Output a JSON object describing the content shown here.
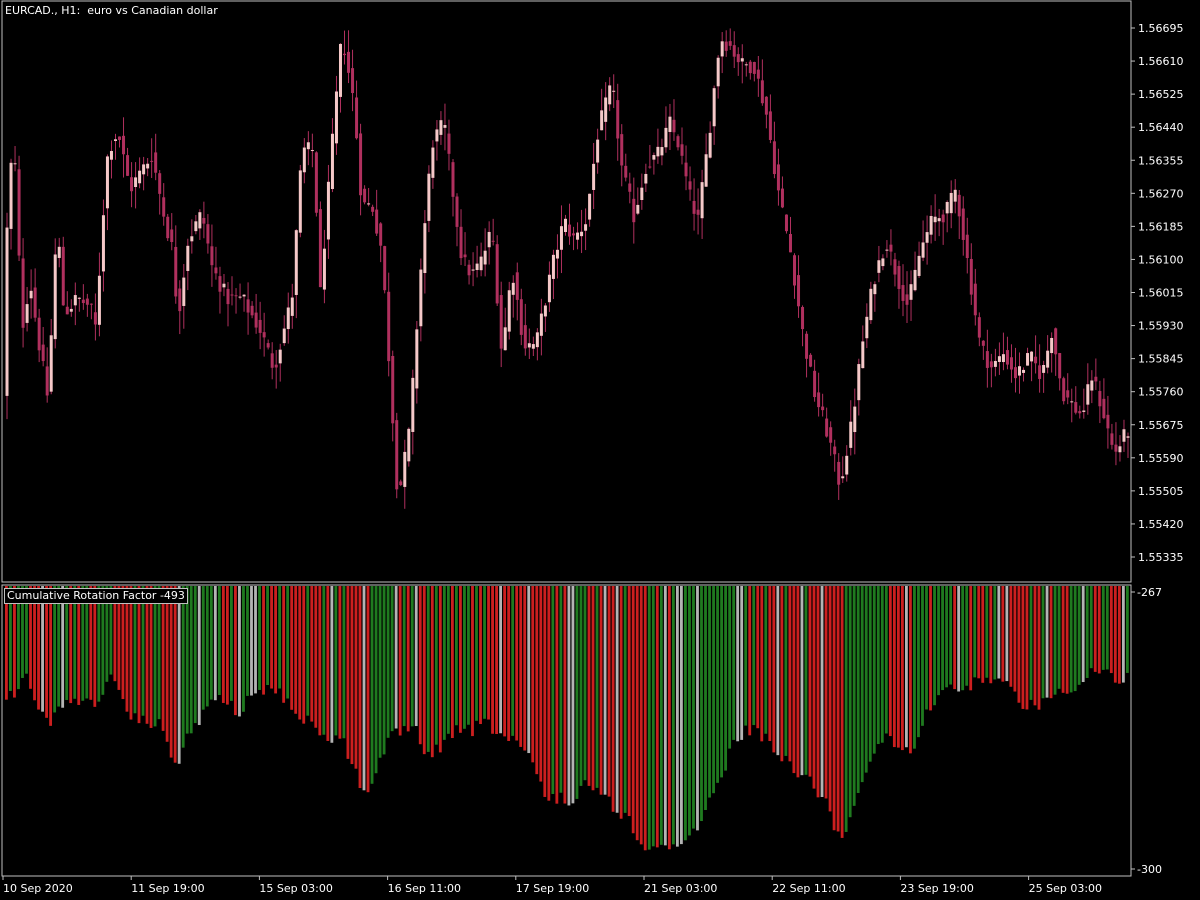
{
  "symbol": "EURCAD.",
  "timeframe": "H1",
  "description": "euro vs Canadian dollar",
  "indicator": {
    "name": "Cumulative Rotation Factor",
    "value": -493
  },
  "colors": {
    "background": "#000000",
    "frame": "#c0c0c0",
    "candle_bull_body": "#f5c8c8",
    "candle_bear_body": "#b0305e",
    "wick": "#b0305e",
    "hist_green": "#1f7a1f",
    "hist_red": "#cc1f1f",
    "hist_gray": "#b4b4b4"
  },
  "chart_data": [
    {
      "type": "candlestick",
      "title": "EURCAD., H1:  euro vs Canadian dollar",
      "y_ticks": [
        "1.56695",
        "1.56610",
        "1.56525",
        "1.56440",
        "1.56355",
        "1.56270",
        "1.56185",
        "1.56100",
        "1.56015",
        "1.55930",
        "1.55845",
        "1.55760",
        "1.55675",
        "1.55590",
        "1.55505",
        "1.55420",
        "1.55335"
      ],
      "ylim": [
        1.5524,
        1.5678
      ],
      "x_ticks": [
        "10 Sep 2020",
        "11 Sep 19:00",
        "15 Sep 03:00",
        "16 Sep 11:00",
        "17 Sep 19:00",
        "21 Sep 03:00",
        "22 Sep 11:00",
        "23 Sep 19:00",
        "25 Sep 03:00"
      ],
      "bar_count": 280,
      "close_path": [
        [
          0,
          1.5565
        ],
        [
          6,
          1.5628
        ],
        [
          12,
          1.564
        ],
        [
          20,
          1.5592
        ],
        [
          28,
          1.5605
        ],
        [
          36,
          1.559
        ],
        [
          46,
          1.5574
        ],
        [
          55,
          1.562
        ],
        [
          62,
          1.5596
        ],
        [
          75,
          1.56
        ],
        [
          88,
          1.5598
        ],
        [
          94,
          1.5592
        ],
        [
          100,
          1.5618
        ],
        [
          106,
          1.5638
        ],
        [
          116,
          1.5643
        ],
        [
          128,
          1.5628
        ],
        [
          140,
          1.5633
        ],
        [
          150,
          1.5637
        ],
        [
          163,
          1.562
        ],
        [
          170,
          1.5613
        ],
        [
          176,
          1.5595
        ],
        [
          186,
          1.5615
        ],
        [
          200,
          1.5622
        ],
        [
          210,
          1.5608
        ],
        [
          225,
          1.56
        ],
        [
          240,
          1.56
        ],
        [
          258,
          1.5592
        ],
        [
          272,
          1.5582
        ],
        [
          290,
          1.56
        ],
        [
          300,
          1.5638
        ],
        [
          312,
          1.5638
        ],
        [
          318,
          1.56
        ],
        [
          328,
          1.5633
        ],
        [
          340,
          1.5668
        ],
        [
          352,
          1.565
        ],
        [
          360,
          1.5624
        ],
        [
          370,
          1.5624
        ],
        [
          380,
          1.5612
        ],
        [
          396,
          1.5548
        ],
        [
          408,
          1.5567
        ],
        [
          418,
          1.5605
        ],
        [
          430,
          1.564
        ],
        [
          442,
          1.5645
        ],
        [
          452,
          1.5625
        ],
        [
          460,
          1.561
        ],
        [
          470,
          1.5606
        ],
        [
          480,
          1.561
        ],
        [
          490,
          1.5618
        ],
        [
          500,
          1.5585
        ],
        [
          510,
          1.5608
        ],
        [
          522,
          1.5588
        ],
        [
          534,
          1.5588
        ],
        [
          550,
          1.5608
        ],
        [
          562,
          1.562
        ],
        [
          572,
          1.5615
        ],
        [
          584,
          1.562
        ],
        [
          596,
          1.5643
        ],
        [
          610,
          1.5655
        ],
        [
          620,
          1.5633
        ],
        [
          632,
          1.5621
        ],
        [
          644,
          1.5634
        ],
        [
          656,
          1.5637
        ],
        [
          668,
          1.5645
        ],
        [
          676,
          1.564
        ],
        [
          688,
          1.5626
        ],
        [
          696,
          1.562
        ],
        [
          706,
          1.564
        ],
        [
          718,
          1.5667
        ],
        [
          728,
          1.5665
        ],
        [
          740,
          1.566
        ],
        [
          752,
          1.566
        ],
        [
          764,
          1.5648
        ],
        [
          776,
          1.5628
        ],
        [
          790,
          1.561
        ],
        [
          800,
          1.5592
        ],
        [
          812,
          1.5576
        ],
        [
          826,
          1.5565
        ],
        [
          838,
          1.5552
        ],
        [
          850,
          1.5568
        ],
        [
          860,
          1.5588
        ],
        [
          872,
          1.5605
        ],
        [
          884,
          1.5615
        ],
        [
          896,
          1.5605
        ],
        [
          906,
          1.5598
        ],
        [
          918,
          1.5612
        ],
        [
          930,
          1.562
        ],
        [
          944,
          1.5622
        ],
        [
          954,
          1.5628
        ],
        [
          964,
          1.5612
        ],
        [
          978,
          1.5588
        ],
        [
          990,
          1.5582
        ],
        [
          1002,
          1.5586
        ],
        [
          1014,
          1.558
        ],
        [
          1028,
          1.5585
        ],
        [
          1040,
          1.558
        ],
        [
          1050,
          1.5592
        ],
        [
          1060,
          1.5576
        ],
        [
          1072,
          1.5572
        ],
        [
          1080,
          1.557
        ],
        [
          1090,
          1.558
        ],
        [
          1100,
          1.5572
        ],
        [
          1112,
          1.556
        ],
        [
          1126,
          1.5566
        ]
      ]
    },
    {
      "type": "histogram",
      "title": "Cumulative Rotation Factor -493",
      "y_ticks": [
        "-267",
        "-300"
      ],
      "ylim": [
        -300,
        -267
      ],
      "bar_count": 280,
      "depth_path": [
        [
          0,
          11
        ],
        [
          6,
          13
        ],
        [
          14,
          13
        ],
        [
          20,
          10
        ],
        [
          28,
          11
        ],
        [
          36,
          14
        ],
        [
          46,
          16
        ],
        [
          56,
          15
        ],
        [
          70,
          13
        ],
        [
          86,
          14
        ],
        [
          100,
          13
        ],
        [
          110,
          11
        ],
        [
          126,
          15
        ],
        [
          140,
          16
        ],
        [
          156,
          16
        ],
        [
          168,
          19
        ],
        [
          176,
          21
        ],
        [
          186,
          18
        ],
        [
          196,
          16
        ],
        [
          212,
          13
        ],
        [
          228,
          14
        ],
        [
          240,
          15
        ],
        [
          254,
          12
        ],
        [
          268,
          12
        ],
        [
          282,
          13
        ],
        [
          296,
          15
        ],
        [
          310,
          16
        ],
        [
          324,
          18
        ],
        [
          340,
          18
        ],
        [
          352,
          21
        ],
        [
          364,
          25
        ],
        [
          376,
          21
        ],
        [
          388,
          18
        ],
        [
          400,
          17
        ],
        [
          414,
          17
        ],
        [
          426,
          20
        ],
        [
          440,
          19
        ],
        [
          456,
          17
        ],
        [
          470,
          17
        ],
        [
          482,
          16
        ],
        [
          494,
          17
        ],
        [
          506,
          18
        ],
        [
          520,
          19
        ],
        [
          532,
          21
        ],
        [
          544,
          25
        ],
        [
          558,
          25
        ],
        [
          572,
          25
        ],
        [
          588,
          23
        ],
        [
          600,
          24
        ],
        [
          612,
          26
        ],
        [
          626,
          27
        ],
        [
          640,
          30
        ],
        [
          654,
          31
        ],
        [
          668,
          31
        ],
        [
          680,
          30
        ],
        [
          694,
          29
        ],
        [
          706,
          26
        ],
        [
          718,
          23
        ],
        [
          730,
          19
        ],
        [
          742,
          17
        ],
        [
          754,
          17
        ],
        [
          766,
          18
        ],
        [
          780,
          20
        ],
        [
          794,
          22
        ],
        [
          810,
          23
        ],
        [
          826,
          26
        ],
        [
          838,
          30
        ],
        [
          850,
          27
        ],
        [
          862,
          22
        ],
        [
          874,
          19
        ],
        [
          886,
          18
        ],
        [
          900,
          19
        ],
        [
          912,
          19
        ],
        [
          924,
          15
        ],
        [
          936,
          13
        ],
        [
          950,
          12
        ],
        [
          964,
          12
        ],
        [
          980,
          11
        ],
        [
          994,
          11
        ],
        [
          1008,
          12
        ],
        [
          1022,
          14
        ],
        [
          1034,
          14
        ],
        [
          1048,
          13
        ],
        [
          1062,
          12
        ],
        [
          1076,
          12
        ],
        [
          1090,
          10
        ],
        [
          1104,
          10
        ],
        [
          1118,
          11
        ],
        [
          1128,
          11
        ]
      ]
    }
  ]
}
